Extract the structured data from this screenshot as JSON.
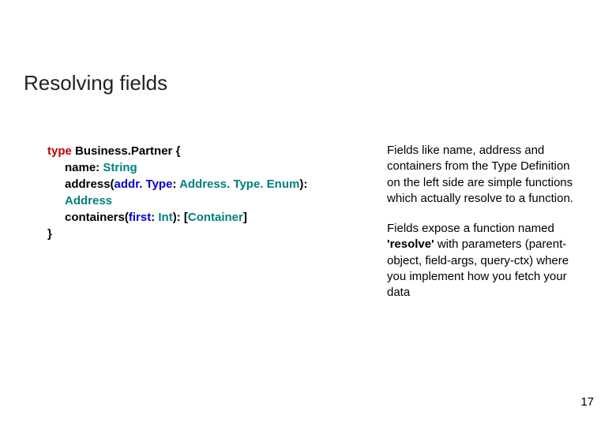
{
  "title": "Resolving fields",
  "code": {
    "l1": {
      "kw": "type",
      "name": " Business.Partner ",
      "brace": "{"
    },
    "l2": {
      "field": "name: ",
      "type": "String"
    },
    "l3": {
      "field": "address(",
      "arg": "addr. Type",
      "colon": ": ",
      "argtype": "Address. Type. Enum",
      "close": "):"
    },
    "l4": {
      "type": "Address"
    },
    "l5": {
      "field": "containers(",
      "arg": "first",
      "colon": ": ",
      "argtype": "Int",
      "close": "): [",
      "rettype": "Container",
      "bracket": "]"
    },
    "l6": {
      "brace": "}"
    }
  },
  "right": {
    "p1": "Fields like name, address and containers from the Type Definition on the left side are simple functions which actually resolve to a function.",
    "p2a": "Fields expose a function named ",
    "p2b": "'resolve'",
    "p2c": " with parameters (parent-object, field-args, query-ctx) where you implement how you fetch your data"
  },
  "pageNumber": "17"
}
